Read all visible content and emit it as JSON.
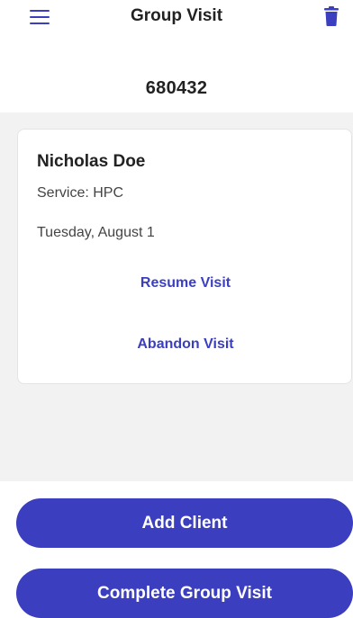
{
  "colors": {
    "accent": "#3b3fbf"
  },
  "header": {
    "title": "Group Visit",
    "menu_icon": "hamburger-menu-icon",
    "delete_icon": "trash-icon"
  },
  "visit": {
    "id": "680432"
  },
  "clients": [
    {
      "name": "Nicholas Doe",
      "service": "Service: HPC",
      "date": "Tuesday, August 1",
      "resume_label": "Resume Visit",
      "abandon_label": "Abandon Visit"
    }
  ],
  "actions": {
    "add_client": "Add Client",
    "complete_group_visit": "Complete Group Visit"
  }
}
